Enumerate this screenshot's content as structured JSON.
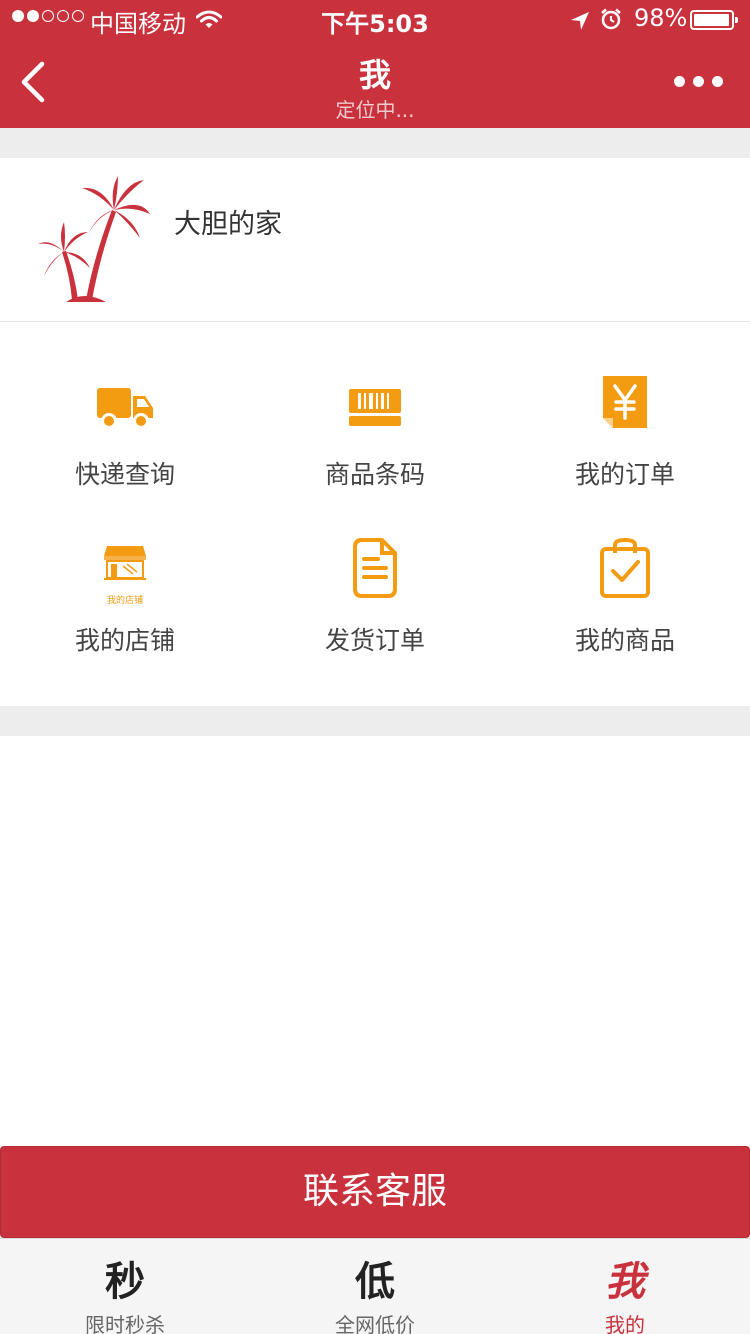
{
  "status_bar": {
    "carrier": "中国移动",
    "time": "下午5:03",
    "battery": "98%",
    "battery_level": 0.98,
    "signal_filled": 2,
    "signal_total": 5
  },
  "nav": {
    "title": "我",
    "subtitle": "定位中...",
    "back_icon": "chevron-left-icon",
    "more_icon": "more-dots-icon"
  },
  "profile": {
    "name": "大胆的家",
    "avatar_icon": "palm-tree-icon"
  },
  "menu": {
    "items": [
      {
        "label": "快递查询",
        "icon": "truck-icon"
      },
      {
        "label": "商品条码",
        "icon": "barcode-icon"
      },
      {
        "label": "我的订单",
        "icon": "yen-document-icon"
      },
      {
        "label": "我的店铺",
        "icon": "storefront-icon",
        "icon_caption": "我的店铺"
      },
      {
        "label": "发货订单",
        "icon": "document-icon"
      },
      {
        "label": "我的商品",
        "icon": "clipboard-check-icon"
      }
    ]
  },
  "contact_button": "联系客服",
  "tabbar": {
    "tabs": [
      {
        "glyph": "秒",
        "label": "限时秒杀",
        "active": false
      },
      {
        "glyph": "低",
        "label": "全网低价",
        "active": false
      },
      {
        "glyph": "我",
        "label": "我的",
        "active": true
      }
    ]
  },
  "colors": {
    "brand_red": "#c9313d",
    "icon_orange": "#f39c12",
    "background_gray": "#ededed"
  }
}
